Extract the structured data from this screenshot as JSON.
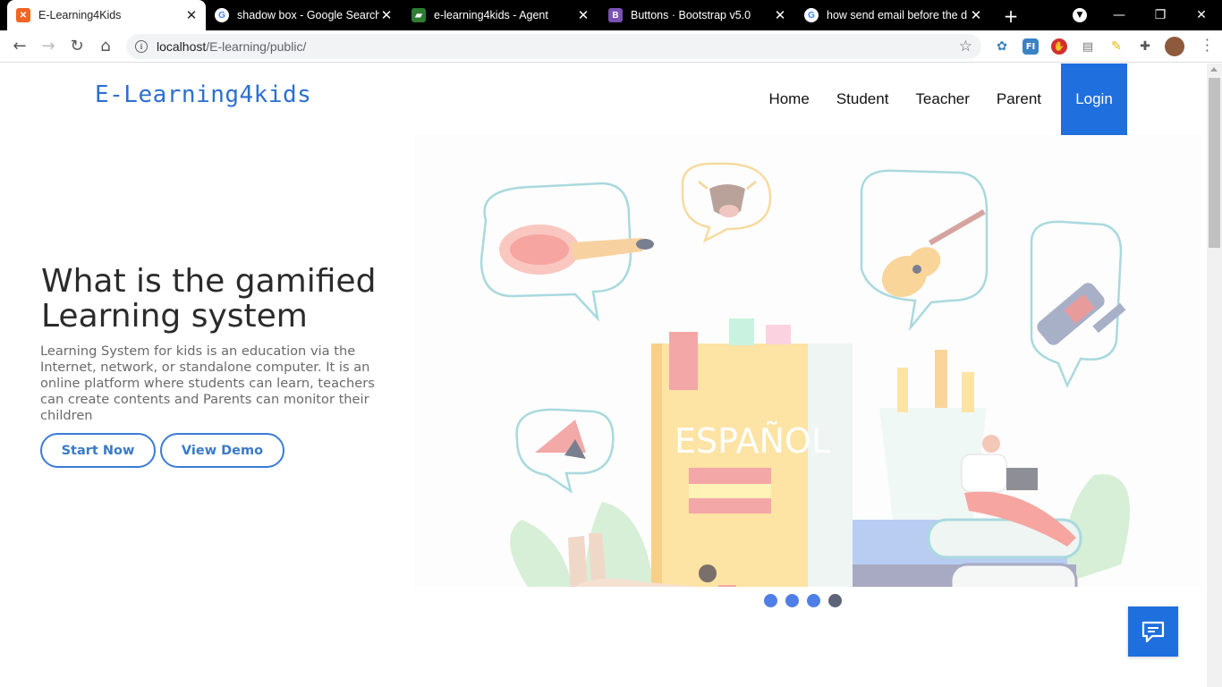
{
  "browser": {
    "tabs": [
      {
        "title": "E-Learning4Kids",
        "favicon": "xampp-icon",
        "color": "#f26522",
        "glyph": "✕"
      },
      {
        "title": "shadow box - Google Search",
        "favicon": "google-icon",
        "color": "#ffffff",
        "glyph": "G"
      },
      {
        "title": "e-learning4kids - Agent",
        "favicon": "agent-icon",
        "color": "#2e7d32",
        "glyph": "▰"
      },
      {
        "title": "Buttons · Bootstrap v5.0",
        "favicon": "bootstrap-icon",
        "color": "#7952b3",
        "glyph": "B"
      },
      {
        "title": "how send email before the d",
        "favicon": "google-icon",
        "color": "#ffffff",
        "glyph": "G"
      }
    ],
    "url_host": "localhost",
    "url_path": "/E-learning/public/"
  },
  "site": {
    "brand": "E-Learning4kids",
    "nav": [
      "Home",
      "Student",
      "Teacher",
      "Parent"
    ],
    "login": "Login",
    "hero_title": "What is the gamified Learning system",
    "hero_desc": "Learning System for kids is an education via the Internet, network, or standalone computer. It is an online platform where students can learn, teachers can create contents and Parents can monitor their children",
    "btn_start": "Start Now",
    "btn_demo": "View Demo",
    "book_title": "ESPAÑOL",
    "carousel_dots": 4,
    "carousel_active": 4,
    "accent": "#1f6fde"
  }
}
